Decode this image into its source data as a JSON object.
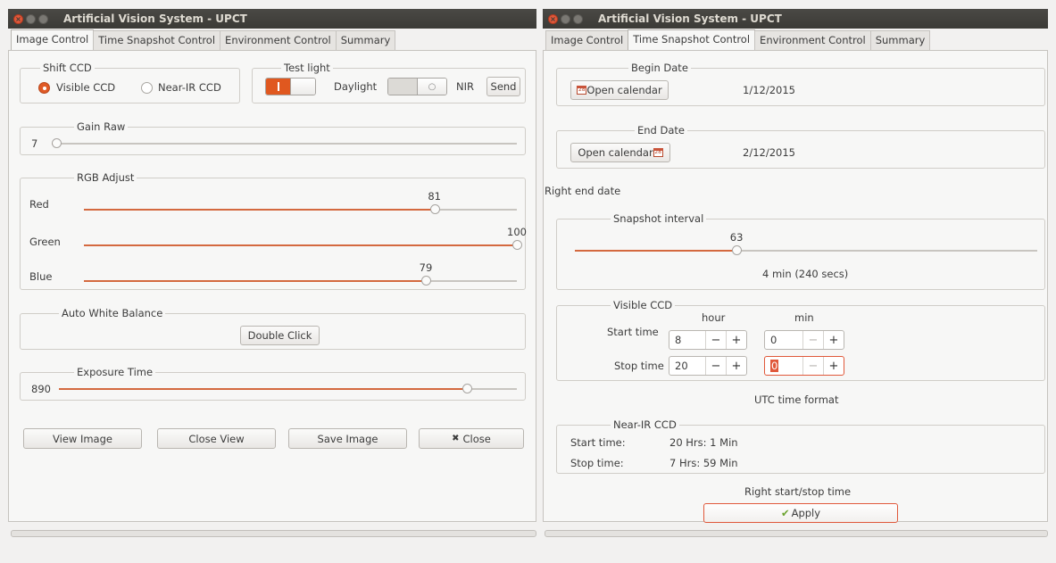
{
  "windows": [
    {
      "title": "Artificial Vision System - UPCT",
      "tabs": [
        "Image Control",
        "Time Snapshot Control",
        "Environment Control",
        "Summary"
      ],
      "active_tab": 0,
      "shift_ccd": {
        "legend": "Shift CCD",
        "options": [
          "Visible CCD",
          "Near-IR CCD"
        ],
        "selected": 0
      },
      "test_light": {
        "legend": "Test light",
        "daylight_label": "Daylight",
        "daylight_on": true,
        "nir_label": "NIR",
        "nir_on": false,
        "send_label": "Send"
      },
      "gain_raw": {
        "legend": "Gain Raw",
        "value": "7",
        "fraction": 0.01
      },
      "rgb_adjust": {
        "legend": "RGB Adjust",
        "channels": [
          {
            "label": "Red",
            "value": "81",
            "fraction": 0.81
          },
          {
            "label": "Green",
            "value": "100",
            "fraction": 1.0
          },
          {
            "label": "Blue",
            "value": "79",
            "fraction": 0.79
          }
        ]
      },
      "auto_white_balance": {
        "legend": "Auto White Balance",
        "button_label": "Double Click"
      },
      "exposure_time": {
        "legend": "Exposure Time",
        "value": "890",
        "fraction": 0.89
      },
      "buttons": {
        "view": "View Image",
        "close_view": "Close View",
        "save": "Save Image",
        "close": "Close",
        "close_icon": "✖"
      }
    },
    {
      "title": "Artificial Vision System - UPCT",
      "tabs": [
        "Image Control",
        "Time Snapshot Control",
        "Environment Control",
        "Summary"
      ],
      "active_tab": 1,
      "begin_date": {
        "legend": "Begin Date",
        "button_label": "Open calendar",
        "date": "1/12/2015"
      },
      "end_date": {
        "legend": "End Date",
        "button_label": "Open calendar",
        "date": "2/12/2015"
      },
      "end_date_status": "Right end date",
      "snapshot_interval": {
        "legend": "Snapshot interval",
        "value": "63",
        "fraction": 0.35,
        "readout": "4 min (240 secs)"
      },
      "visible_ccd": {
        "legend": "Visible CCD",
        "hour_header": "hour",
        "min_header": "min",
        "start_label": "Start time",
        "stop_label": "Stop time",
        "start_hour": "8",
        "start_min": "0",
        "stop_hour": "20",
        "stop_min": "0",
        "minus": "−",
        "plus": "+"
      },
      "utc_note": "UTC time format",
      "near_ir_ccd": {
        "legend": "Near-IR CCD",
        "start_label": "Start time:",
        "start_value": "20 Hrs: 1 Min",
        "stop_label": "Stop time:",
        "stop_value": "7 Hrs: 59 Min"
      },
      "status_message": "Right start/stop time",
      "apply_label": "Apply",
      "apply_icon": "✔"
    }
  ],
  "colors": {
    "accent": "#e0581f",
    "slider_fill": "#d4693f",
    "titlebar": "#3b3a36",
    "background": "#f2f1f0"
  }
}
